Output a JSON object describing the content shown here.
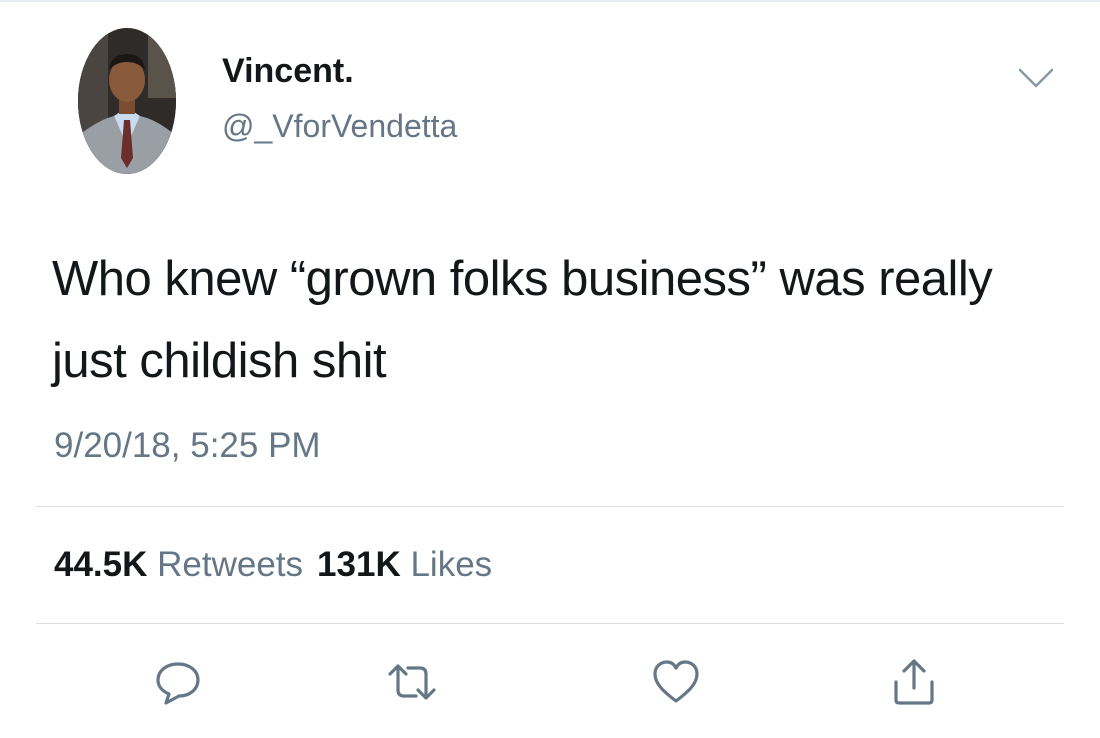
{
  "tweet": {
    "author": {
      "display_name": "Vincent.",
      "handle": "@_VforVendetta"
    },
    "text": "Who knew “grown folks business” was really just childish shit",
    "timestamp": "9/20/18, 5:25 PM",
    "stats": {
      "retweets_count": "44.5K",
      "retweets_label": "Retweets",
      "likes_count": "131K",
      "likes_label": "Likes"
    }
  },
  "icons": {
    "avatar": "profile-photo",
    "more": "chevron-down-icon",
    "reply": "reply-icon",
    "retweet": "retweet-icon",
    "like": "heart-icon",
    "share": "share-icon"
  },
  "colors": {
    "primary_text": "#14171a",
    "secondary_text": "#657786",
    "divider": "#d9dee2"
  }
}
